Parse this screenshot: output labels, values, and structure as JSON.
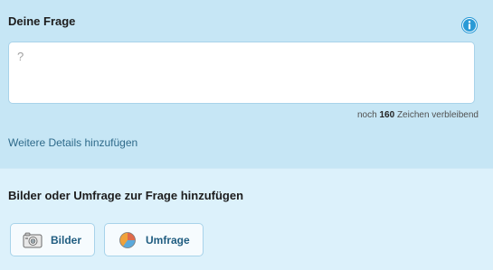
{
  "question": {
    "title": "Deine Frage",
    "placeholder": "?",
    "value": "",
    "counter_prefix": "noch",
    "counter_count": "160",
    "counter_suffix": "Zeichen verbleibend",
    "details_link": "Weitere Details hinzufügen",
    "info_icon": "info-icon"
  },
  "media": {
    "title": "Bilder oder Umfrage zur Frage hinzufügen",
    "buttons": [
      {
        "label": "Bilder",
        "icon": "camera-icon"
      },
      {
        "label": "Umfrage",
        "icon": "pie-chart-icon"
      }
    ]
  },
  "colors": {
    "top_panel": "#c6e6f5",
    "bottom_panel": "#dcf1fb",
    "link": "#2e6a8a",
    "button_text": "#1f5c80",
    "info_icon": "#2a9ad6"
  }
}
